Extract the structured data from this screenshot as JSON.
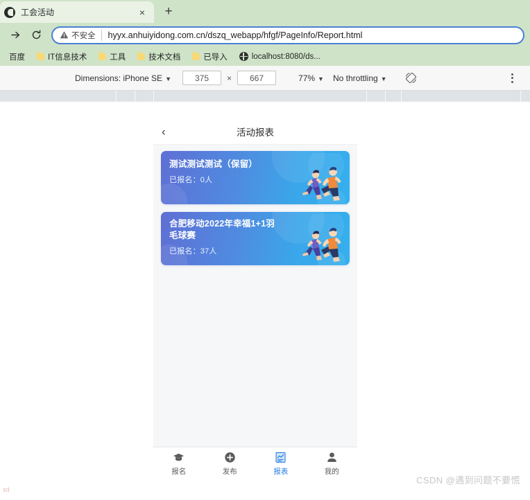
{
  "browser": {
    "tab": {
      "title": "工会活动",
      "favicon": "globe-favicon",
      "close_label": "×"
    },
    "new_tab_label": "+",
    "nav": {
      "forward": "→",
      "reload": "⟳"
    },
    "omnibox": {
      "security_label": "不安全",
      "security_icon": "warning-triangle-icon",
      "url": "hyyx.anhuiyidong.com.cn/dszq_webapp/hfgf/PageInfo/Report.html"
    },
    "bookmarks": [
      {
        "label": "百度",
        "icon": "none"
      },
      {
        "label": "IT信息技术",
        "icon": "folder"
      },
      {
        "label": "工具",
        "icon": "folder"
      },
      {
        "label": "技术文档",
        "icon": "folder"
      },
      {
        "label": "已导入",
        "icon": "folder"
      },
      {
        "label": "localhost:8080/ds...",
        "icon": "globe"
      }
    ]
  },
  "device_toolbar": {
    "dimensions_label": "Dimensions: iPhone SE",
    "width": "375",
    "height": "667",
    "times": "×",
    "zoom": "77%",
    "throttling": "No throttling",
    "rotate_icon": "rotate-icon",
    "menu_icon": "more-vertical-icon",
    "caret": "▼"
  },
  "app": {
    "header": {
      "back_icon": "‹",
      "title": "活动报表"
    },
    "cards": [
      {
        "name": "测试测试测试（保留）",
        "count_label": "已报名：0人",
        "illustration": "runners-illustration"
      },
      {
        "name": "合肥移动2022年幸福1+1羽毛球赛",
        "count_label": "已报名：37人",
        "illustration": "runners-illustration"
      }
    ],
    "tabbar": [
      {
        "label": "报名",
        "icon": "graduation-cap-icon",
        "active": false
      },
      {
        "label": "发布",
        "icon": "plus-circle-icon",
        "active": false
      },
      {
        "label": "报表",
        "icon": "report-chart-icon",
        "active": true
      },
      {
        "label": "我的",
        "icon": "person-icon",
        "active": false
      }
    ]
  },
  "overlay": {
    "watermark": "CSDN @遇到问题不要慌",
    "corner_text": "sd"
  },
  "colors": {
    "chrome_bg": "#cfe3c8",
    "omnibox_border": "#4b7fd4",
    "card_gradient_start": "#5f6fd4",
    "card_gradient_end": "#35b0ee",
    "tab_active": "#2a7fe0"
  }
}
